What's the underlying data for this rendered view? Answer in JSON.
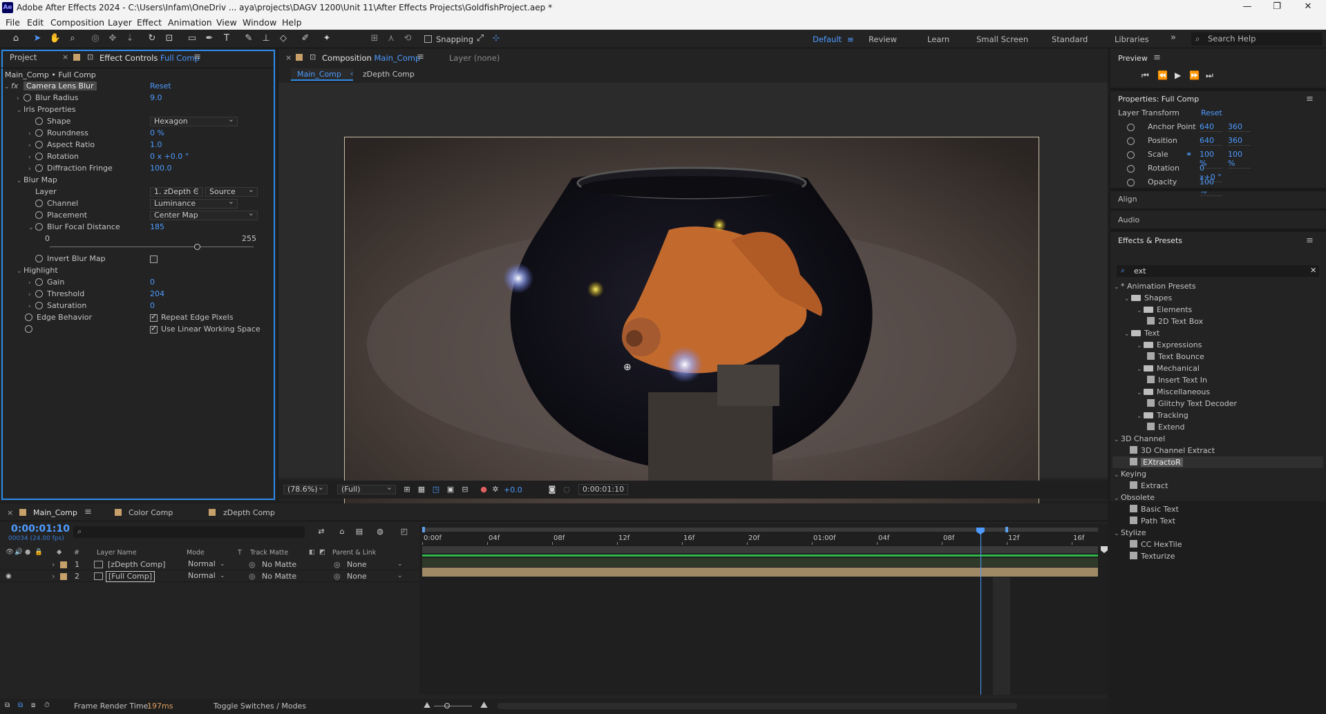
{
  "app": {
    "logo": "Ae",
    "window_title": "Adobe After Effects 2024 - C:\\Users\\Infam\\OneDriv ... aya\\projects\\DAGV 1200\\Unit 11\\After Effects Projects\\GoldfishProject.aep *",
    "window_controls": [
      "—",
      "❐",
      "✕"
    ]
  },
  "menu": [
    "File",
    "Edit",
    "Composition",
    "Layer",
    "Effect",
    "Animation",
    "View",
    "Window",
    "Help"
  ],
  "toolbar": {
    "snapping_label": "Snapping",
    "workspaces": [
      "Default",
      "Review",
      "Learn",
      "Small Screen",
      "Standard",
      "Libraries"
    ],
    "active_workspace": "Default",
    "more_icon": "»",
    "search_placeholder": "Search Help"
  },
  "left_panel": {
    "tab_project": "Project",
    "tab_effect_controls": "Effect Controls",
    "tab_effect_target": "Full Comp",
    "breadcrumb": "Main_Comp • Full Comp",
    "effect_name": "Camera Lens Blur",
    "reset_label": "Reset",
    "props": {
      "blur_radius": {
        "label": "Blur Radius",
        "value": "9.0"
      },
      "iris_properties": "Iris Properties",
      "shape": {
        "label": "Shape",
        "value": "Hexagon"
      },
      "roundness": {
        "label": "Roundness",
        "value": "0 %"
      },
      "aspect_ratio": {
        "label": "Aspect Ratio",
        "value": "1.0"
      },
      "rotation": {
        "label": "Rotation",
        "value": "0 x +0.0 °"
      },
      "diffraction_fringe": {
        "label": "Diffraction Fringe",
        "value": "100.0"
      },
      "blur_map": "Blur Map",
      "layer": {
        "label": "Layer",
        "value": "1. zDepth C",
        "source": "Source"
      },
      "channel": {
        "label": "Channel",
        "value": "Luminance"
      },
      "placement": {
        "label": "Placement",
        "value": "Center Map"
      },
      "blur_focal_distance": {
        "label": "Blur Focal Distance",
        "value": "185",
        "min": "0",
        "max": "255",
        "fraction": 0.725
      },
      "invert_blur_map": {
        "label": "Invert Blur Map"
      },
      "highlight": "Highlight",
      "gain": {
        "label": "Gain",
        "value": "0"
      },
      "threshold": {
        "label": "Threshold",
        "value": "204"
      },
      "saturation": {
        "label": "Saturation",
        "value": "0"
      },
      "edge_behavior": {
        "label": "Edge Behavior",
        "option": "Repeat Edge Pixels"
      },
      "linear": {
        "option": "Use Linear Working Space"
      }
    }
  },
  "comp_panel": {
    "tab_label": "Composition",
    "tab_comp": "Main_Comp",
    "layer_tab": "Layer (none)",
    "flow_active": "Main_Comp",
    "flow_next": "zDepth Comp",
    "zoom": "(78.6%)",
    "resolution": "(Full)",
    "exposure": "+0.0",
    "timecode": "0:00:01:10"
  },
  "right_panel": {
    "preview_title": "Preview",
    "properties_title": "Properties: Full Comp",
    "layer_transform": "Layer Transform",
    "reset_label": "Reset",
    "transform": [
      {
        "label": "Anchor Point",
        "v1": "640",
        "v2": "360"
      },
      {
        "label": "Position",
        "v1": "640",
        "v2": "360"
      },
      {
        "label": "Scale",
        "v1": "100 %",
        "v2": "100 %"
      },
      {
        "label": "Rotation",
        "v1": "0 x+0 °",
        "v2": ""
      },
      {
        "label": "Opacity",
        "v1": "100 %",
        "v2": ""
      }
    ],
    "align": "Align",
    "audio": "Audio",
    "effects_title": "Effects & Presets",
    "search_value": "ext",
    "tree": [
      {
        "depth": 0,
        "kind": "cat",
        "label": "* Animation Presets"
      },
      {
        "depth": 1,
        "kind": "folder",
        "label": "Shapes"
      },
      {
        "depth": 2,
        "kind": "folder",
        "label": "Elements"
      },
      {
        "depth": 3,
        "kind": "preset",
        "label": "2D Text Box"
      },
      {
        "depth": 1,
        "kind": "folder",
        "label": "Text"
      },
      {
        "depth": 2,
        "kind": "folder",
        "label": "Expressions"
      },
      {
        "depth": 3,
        "kind": "preset",
        "label": "Text Bounce"
      },
      {
        "depth": 2,
        "kind": "folder",
        "label": "Mechanical"
      },
      {
        "depth": 3,
        "kind": "preset",
        "label": "Insert Text In"
      },
      {
        "depth": 2,
        "kind": "folder",
        "label": "Miscellaneous"
      },
      {
        "depth": 3,
        "kind": "preset",
        "label": "Glitchy Text Decoder"
      },
      {
        "depth": 2,
        "kind": "folder",
        "label": "Tracking"
      },
      {
        "depth": 3,
        "kind": "preset",
        "label": "Extend"
      },
      {
        "depth": 0,
        "kind": "cat",
        "label": "3D Channel"
      },
      {
        "depth": 1,
        "kind": "effect",
        "label": "3D Channel Extract"
      },
      {
        "depth": 1,
        "kind": "effect",
        "label": "EXtractoR",
        "selected": true
      },
      {
        "depth": 0,
        "kind": "cat",
        "label": "Keying"
      },
      {
        "depth": 1,
        "kind": "effect",
        "label": "Extract"
      },
      {
        "depth": 0,
        "kind": "cat",
        "label": "Obsolete"
      },
      {
        "depth": 1,
        "kind": "effect",
        "label": "Basic Text"
      },
      {
        "depth": 1,
        "kind": "effect",
        "label": "Path Text"
      },
      {
        "depth": 0,
        "kind": "cat",
        "label": "Stylize"
      },
      {
        "depth": 1,
        "kind": "effect",
        "label": "CC HexTile"
      },
      {
        "depth": 1,
        "kind": "effect",
        "label": "Texturize"
      }
    ]
  },
  "timeline": {
    "tabs": [
      "Main_Comp",
      "Color Comp",
      "zDepth Comp"
    ],
    "timecode": "0:00:01:10",
    "frames": "00034 (24.00 fps)",
    "columns": {
      "num": "#",
      "name": "Layer Name",
      "mode": "Mode",
      "t": "T",
      "track_matte": "Track Matte",
      "parent": "Parent & Link"
    },
    "layers": [
      {
        "num": "1",
        "name": "[zDepth Comp]",
        "mode": "Normal",
        "matte": "No Matte",
        "parent": "None",
        "eye": false
      },
      {
        "num": "2",
        "name": "[Full Comp]",
        "mode": "Normal",
        "matte": "No Matte",
        "parent": "None",
        "eye": true
      }
    ],
    "ruler": [
      "0:00f",
      "04f",
      "08f",
      "12f",
      "16f",
      "20f",
      "01:00f",
      "04f",
      "08f",
      "12f",
      "16f"
    ],
    "playhead_fraction": 0.826,
    "frame_render_label": "Frame Render Time:",
    "frame_render_value": "197ms",
    "toggle_label": "Toggle Switches / Modes"
  }
}
